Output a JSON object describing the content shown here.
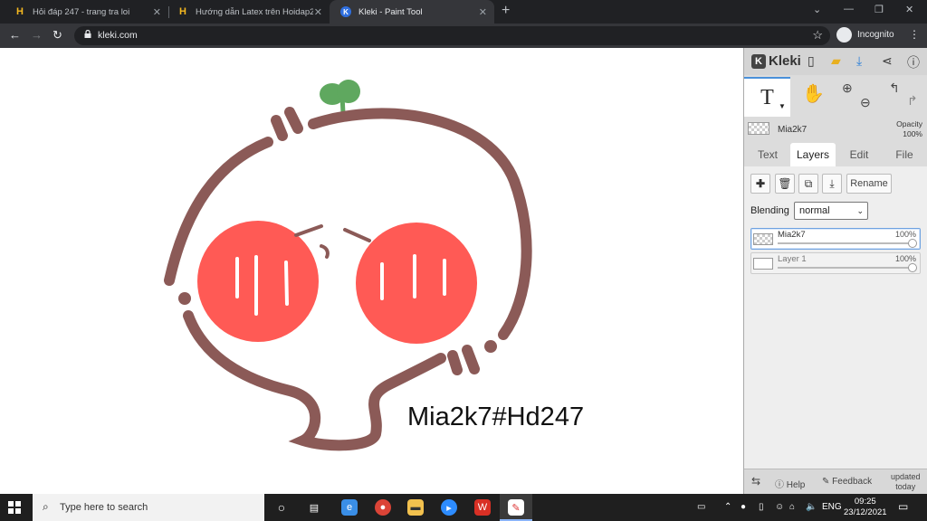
{
  "browser": {
    "tabs": [
      {
        "favicon": "hoidap-h-icon",
        "title": "Hỏi đáp 247 - trang tra loi",
        "active": false
      },
      {
        "favicon": "hoidap-h-icon",
        "title": "Hướng dẫn Latex trên Hoidap247",
        "active": false
      },
      {
        "favicon": "kleki-icon",
        "title": "Kleki - Paint Tool",
        "active": true
      }
    ],
    "url": "kleki.com",
    "profile_label": "Incognito"
  },
  "canvas": {
    "text": "Mia2k7#Hd247",
    "colors": {
      "outline": "#8b5a57",
      "cheek": "#ff5a55",
      "leaf": "#5fa85f",
      "background": "#ffffff"
    }
  },
  "kleki": {
    "logo": "Kleki",
    "current_layer": {
      "name": "Mia2k7",
      "opacity_label": "Opacity",
      "opacity_value": "100%"
    },
    "tabs": [
      "Text",
      "Layers",
      "Edit",
      "File"
    ],
    "active_tab": "Layers",
    "rename_label": "Rename",
    "blending_label": "Blending",
    "blending_value": "normal",
    "layers": [
      {
        "name": "Mia2k7",
        "opacity": "100%",
        "selected": true
      },
      {
        "name": "Layer 1",
        "opacity": "100%",
        "selected": false
      }
    ],
    "footer": {
      "help": "Help",
      "feedback": "Feedback",
      "updated_line1": "updated",
      "updated_line2": "today"
    }
  },
  "taskbar": {
    "search_placeholder": "Type here to search",
    "language": "ENG",
    "time": "09:25",
    "date": "23/12/2021"
  }
}
